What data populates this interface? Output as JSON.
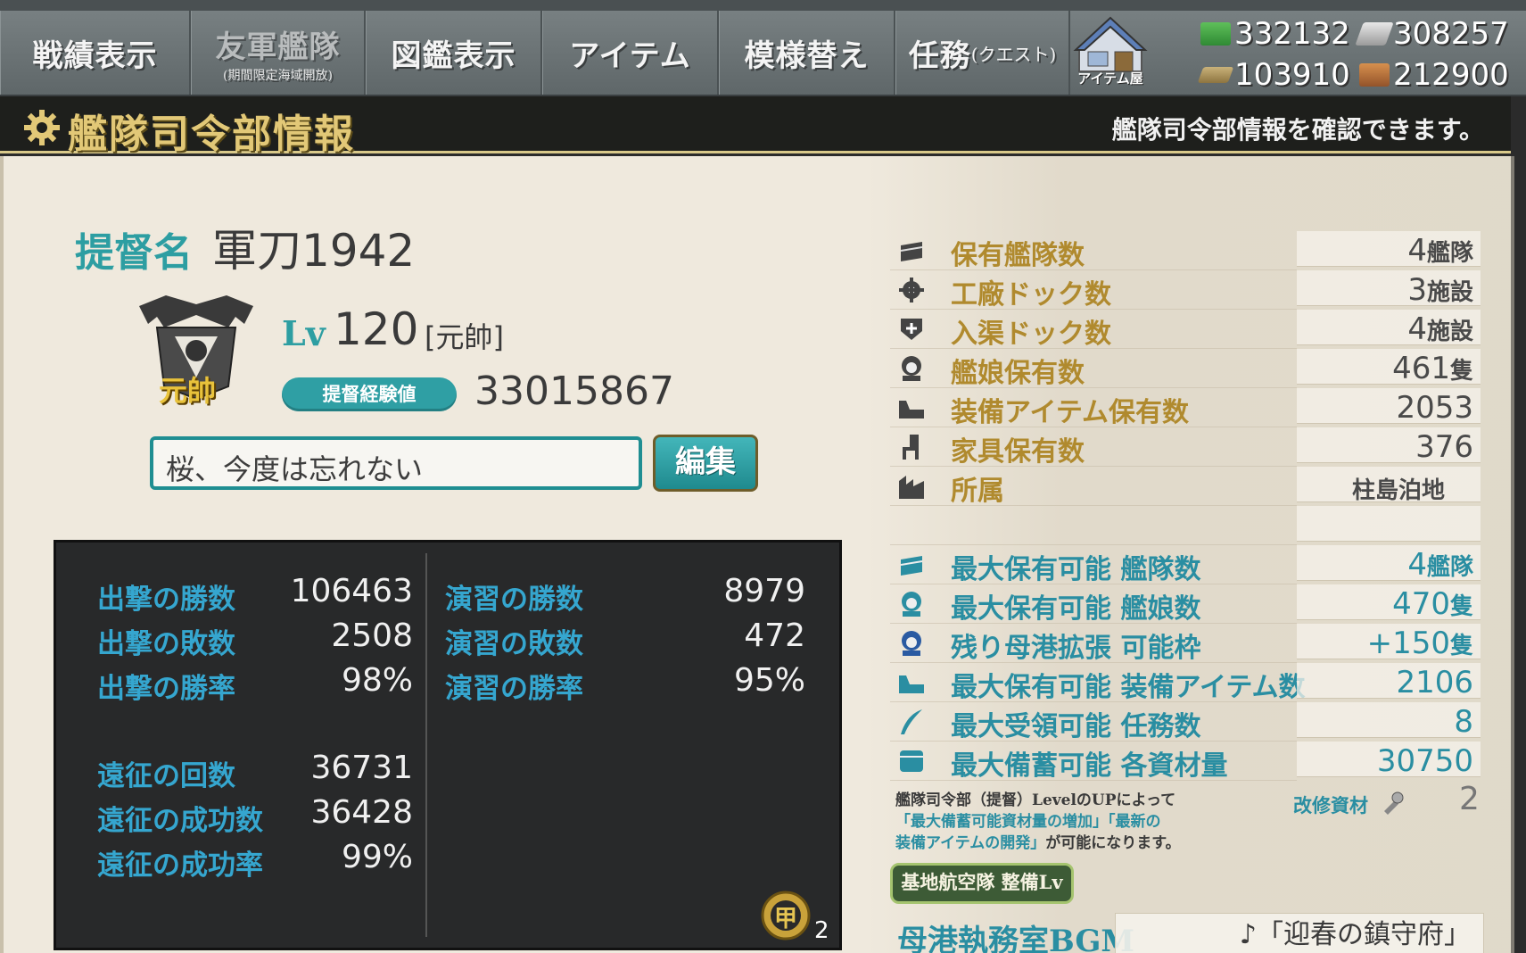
{
  "nav": {
    "tabs": [
      {
        "label": "戦績表示",
        "sub": ""
      },
      {
        "label": "友軍艦隊",
        "sub": "(期間限定海域開放)"
      },
      {
        "label": "図鑑表示",
        "sub": ""
      },
      {
        "label": "アイテム",
        "sub": ""
      },
      {
        "label": "模様替え",
        "sub": ""
      },
      {
        "label": "任務",
        "small": "(クエスト)"
      }
    ],
    "shop_label": "アイテム屋"
  },
  "resources": {
    "fuel": "332132",
    "ammo": "308257",
    "steel": "103910",
    "bauxite": "212900"
  },
  "header": {
    "title": "艦隊司令部情報",
    "description": "艦隊司令部情報を確認できます。"
  },
  "admiral": {
    "name_label": "提督名",
    "name": "軍刀1942",
    "lv_label": "Lv",
    "level": "120",
    "rank": "[元帥]",
    "rank_emblem_text": "元帥",
    "exp_label": "提督経験値",
    "exp": "33015867",
    "comment": "桜、今度は忘れない",
    "edit_label": "編集"
  },
  "stats": {
    "sortie_wins_label": "出撃の勝数",
    "sortie_wins": "106463",
    "sortie_losses_label": "出撃の敗数",
    "sortie_losses": "2508",
    "sortie_rate_label": "出撃の勝率",
    "sortie_rate": "98%",
    "exercise_wins_label": "演習の勝数",
    "exercise_wins": "8979",
    "exercise_losses_label": "演習の敗数",
    "exercise_losses": "472",
    "exercise_rate_label": "演習の勝率",
    "exercise_rate": "95%",
    "exped_count_label": "遠征の回数",
    "exped_count": "36731",
    "exped_success_label": "遠征の成功数",
    "exped_success": "36428",
    "exped_rate_label": "遠征の成功率",
    "exped_rate": "99%",
    "medal_text": "甲",
    "medal_count": "2"
  },
  "info": {
    "fleets_label": "保有艦隊数",
    "fleets": "4",
    "fleets_unit": "艦隊",
    "build_docks_label": "工廠ドック数",
    "build_docks": "3",
    "build_docks_unit": "施設",
    "repair_docks_label": "入渠ドック数",
    "repair_docks": "4",
    "repair_docks_unit": "施設",
    "ships_label": "艦娘保有数",
    "ships": "461",
    "ships_unit": "隻",
    "equip_label": "装備アイテム保有数",
    "equip": "2053",
    "furniture_label": "家具保有数",
    "furniture": "376",
    "affiliation_label": "所属",
    "affiliation": "柱島泊地",
    "max_fleets_label": "最大保有可能 艦隊数",
    "max_fleets": "4",
    "max_fleets_unit": "艦隊",
    "max_ships_label": "最大保有可能 艦娘数",
    "max_ships": "470",
    "max_ships_unit": "隻",
    "port_expand_label": "残り母港拡張 可能枠",
    "port_expand": "+150",
    "port_expand_unit": "隻",
    "max_equip_label": "最大保有可能 装備アイテム数",
    "max_equip": "2106",
    "max_quests_label": "最大受領可能 任務数",
    "max_quests": "8",
    "max_resources_label": "最大備蓄可能 各資材量",
    "max_resources": "30750"
  },
  "note": {
    "line1": "艦隊司令部（提督）LevelのUPによって",
    "line2_hl": "「最大備蓄可能資材量の増加」「最新の",
    "line3_hl": "装備アイテムの開発」",
    "line3_rest": "が可能になります。"
  },
  "improvement": {
    "label": "改修資材",
    "value": "2"
  },
  "base_air": {
    "label": "基地航空隊 整備Lv"
  },
  "bgm": {
    "label": "母港執務室BGM",
    "value": "♪「迎春の鎮守府」"
  },
  "colors": {
    "accent_teal": "#2d9ea2",
    "gold": "#b08a2e",
    "stats_blue": "#35a6cf",
    "header_gold": "#e2c877"
  }
}
